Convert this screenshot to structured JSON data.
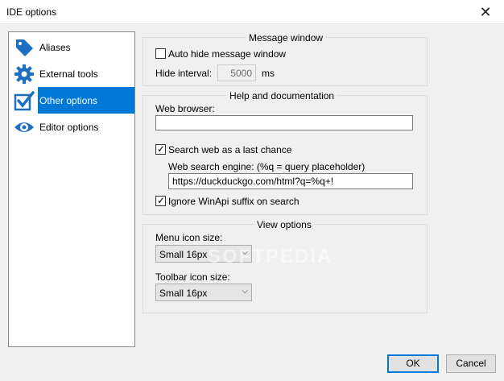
{
  "window": {
    "title": "IDE options",
    "close_glyph": "✕"
  },
  "sidebar": {
    "items": [
      {
        "label": "Aliases",
        "icon": "tag-icon",
        "selected": false
      },
      {
        "label": "External tools",
        "icon": "gear-icon",
        "selected": false
      },
      {
        "label": "Other options",
        "icon": "checkmark-icon",
        "selected": true
      },
      {
        "label": "Editor options",
        "icon": "eye-icon",
        "selected": false
      }
    ]
  },
  "message_window": {
    "title": "Message window",
    "auto_hide_label": "Auto hide message window",
    "auto_hide_checked": false,
    "hide_interval_label": "Hide interval:",
    "hide_interval_value": "5000",
    "hide_interval_unit": "ms"
  },
  "help": {
    "title": "Help and documentation",
    "web_browser_label": "Web browser:",
    "web_browser_value": "",
    "search_web_label": "Search web as a last chance",
    "search_web_checked": true,
    "search_engine_label": "Web search engine: (%q = query placeholder)",
    "search_engine_value": "https://duckduckgo.com/html?q=%q+!",
    "ignore_winapi_label": "Ignore WinApi suffix on search",
    "ignore_winapi_checked": true
  },
  "view": {
    "title": "View options",
    "menu_icon_label": "Menu icon size:",
    "menu_icon_value": "Small  16px",
    "toolbar_icon_label": "Toolbar icon size:",
    "toolbar_icon_value": "Small  16px"
  },
  "footer": {
    "ok_label": "OK",
    "cancel_label": "Cancel"
  },
  "watermark": "SOFTPEDIA",
  "colors": {
    "accent": "#0078d7",
    "icon": "#1d6fc0"
  }
}
